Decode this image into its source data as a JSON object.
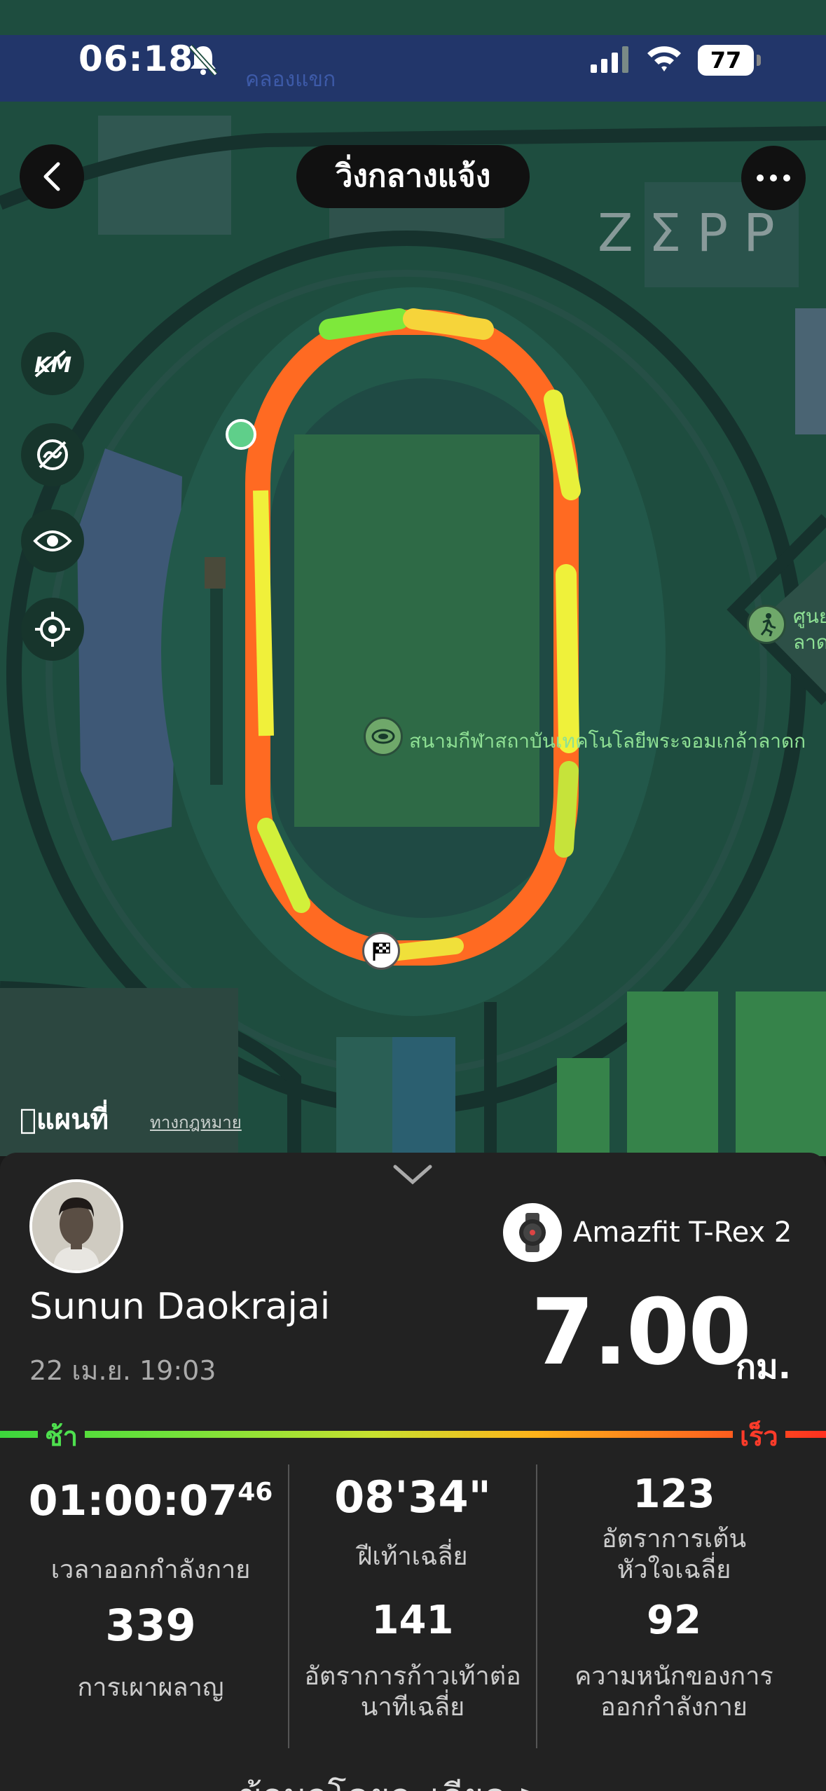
{
  "status_bar": {
    "time": "06:18",
    "battery": "77",
    "street_label": "คลองแขก"
  },
  "header": {
    "title": "วิ่งกลางแจ้ง",
    "brand_logo": "ZΣPP",
    "back_icon": "chevron-left-icon",
    "more_icon": "ellipsis-icon"
  },
  "map_controls": [
    "km-markers-toggle-icon",
    "hide-route-icon",
    "eye-icon",
    "locate-icon"
  ],
  "map": {
    "stadium_label": "สนามกีฬาสถาบันเทคโนโลยีพระจอมเกล้าลาดก",
    "side_label_line1": "ศูนย",
    "side_label_line2": "ลาด",
    "attribution_brand": "แผนที่",
    "legal_link": "ทางกฎหมาย"
  },
  "profile": {
    "name": "Sunun Daokrajai",
    "date": "22 เม.ย. 19:03",
    "device": "Amazfit T-Rex 2"
  },
  "distance": {
    "value": "7.00",
    "unit": "กม."
  },
  "pace_scale": {
    "slow": "ช้า",
    "fast": "เร็ว"
  },
  "stats": {
    "duration_main": "01:00:07",
    "duration_fraction": "46",
    "duration_label": "เวลาออกกำลังกาย",
    "pace_value": "08'34\"",
    "pace_label": "ฝีเท้าเฉลี่ย",
    "heart_rate_value": "123",
    "heart_rate_label_1": "อัตราการเต้น",
    "heart_rate_label_2": "หัวใจเฉลี่ย",
    "calories_value": "339",
    "calories_label": "การเผาผลาญ",
    "cadence_value": "141",
    "cadence_label_1": "อัตราการก้าวเท้าต่อ",
    "cadence_label_2": "นาทีเฉลี่ย",
    "load_value": "92",
    "load_label_1": "ความหนักของการ",
    "load_label_2": "ออกกำลังกาย"
  },
  "details_link": "ข้อมูลโดยละเอียด >"
}
